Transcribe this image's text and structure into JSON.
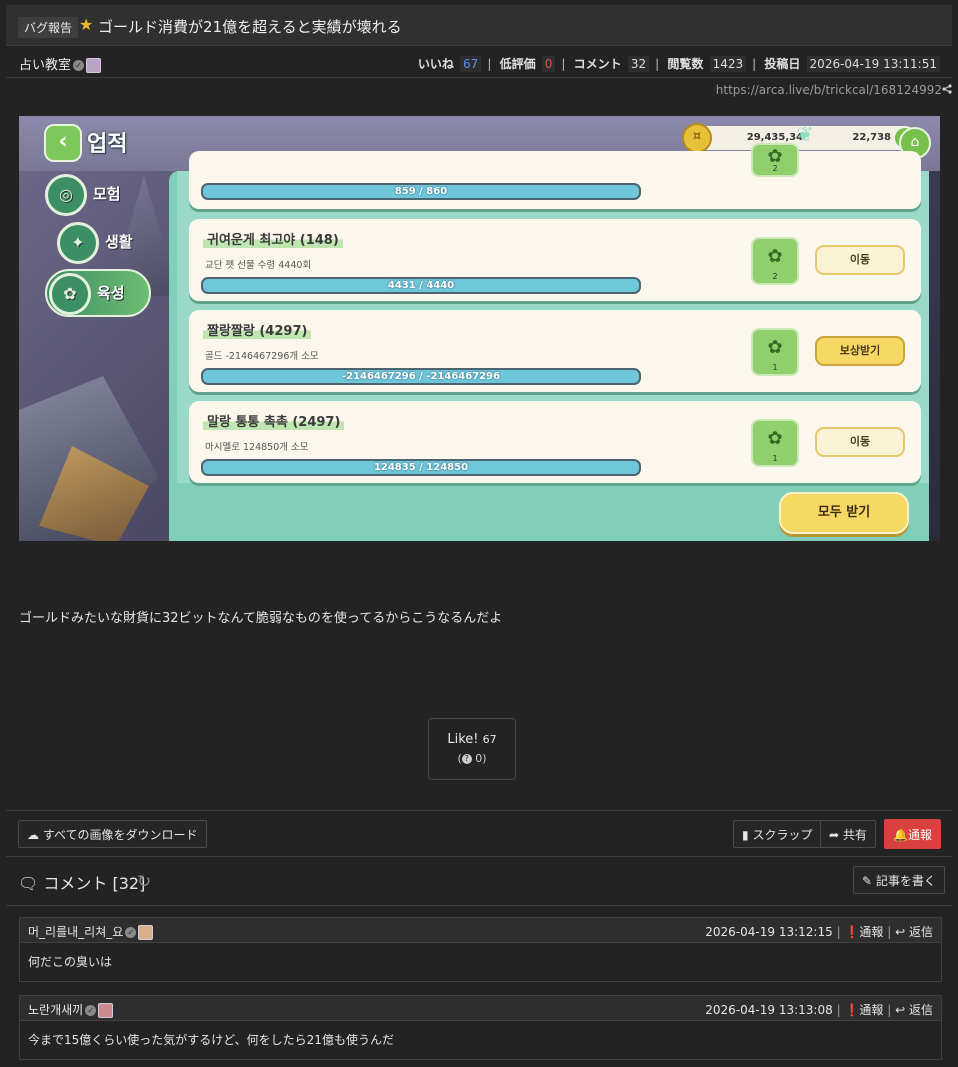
{
  "post": {
    "category": "バグ報告",
    "title": "ゴールド消費が21億を超えると実績が壊れる",
    "author": "占い教室",
    "stats": {
      "likes_label": "いいね",
      "likes": "67",
      "dislikes_label": "低評価",
      "dislikes": "0",
      "comments_label": "コメント",
      "comments": "32",
      "views_label": "閲覧数",
      "views": "1423",
      "date_label": "投稿日",
      "date": "2026-04-19 13:11:51"
    },
    "url": "https://arca.live/b/trickcal/168124992",
    "body": "ゴールドみたいな財貨に32ビットなんて脆弱なものを使ってるからこうなるんだよ",
    "like_button": {
      "label": "Like!",
      "count": "67",
      "dislike_count": "0"
    }
  },
  "screenshot": {
    "title": "업적",
    "gold": "29,435,342",
    "gems": "22,738",
    "tabs": [
      {
        "label": "모험"
      },
      {
        "label": "생활"
      },
      {
        "label": "육성"
      }
    ],
    "partial_progress": "859 / 860",
    "partial_reward_count": "2",
    "cards": [
      {
        "title": "귀여운게 최고야 (148)",
        "desc": "교단 펫 선물 수령 4440회",
        "progress": "4431 / 4440",
        "reward_count": "2",
        "button": "이동"
      },
      {
        "title": "짤랑짤랑 (4297)",
        "desc": "골드 -2146467296개 소모",
        "progress": "-2146467296 / -2146467296",
        "reward_count": "1",
        "button": "보상받기"
      },
      {
        "title": "말랑 통통 촉촉 (2497)",
        "desc": "마시멜로 124850개 소모",
        "progress": "124835 / 124850",
        "reward_count": "1",
        "button": "이동"
      }
    ],
    "claim_all": "모두 받기"
  },
  "actions": {
    "download_all": "すべての画像をダウンロード",
    "scrap": "スクラップ",
    "share": "共有",
    "report": "通報"
  },
  "comments_section": {
    "heading": "コメント [32]",
    "write": "記事を書く",
    "report_label": "通報",
    "reply_label": "返信",
    "items": [
      {
        "user": "머_리를내_리쳐_요",
        "date": "2026-04-19 13:12:15",
        "text": "何だこの臭いは"
      },
      {
        "user": "노란개새끼",
        "date": "2026-04-19 13:13:08",
        "text": "今まで15億くらい使った気がするけど、何をしたら21億も使うんだ"
      }
    ]
  },
  "colors": {
    "accent_red": "#d94141",
    "like_blue": "#5a8ef0",
    "star": "#f0b429"
  }
}
